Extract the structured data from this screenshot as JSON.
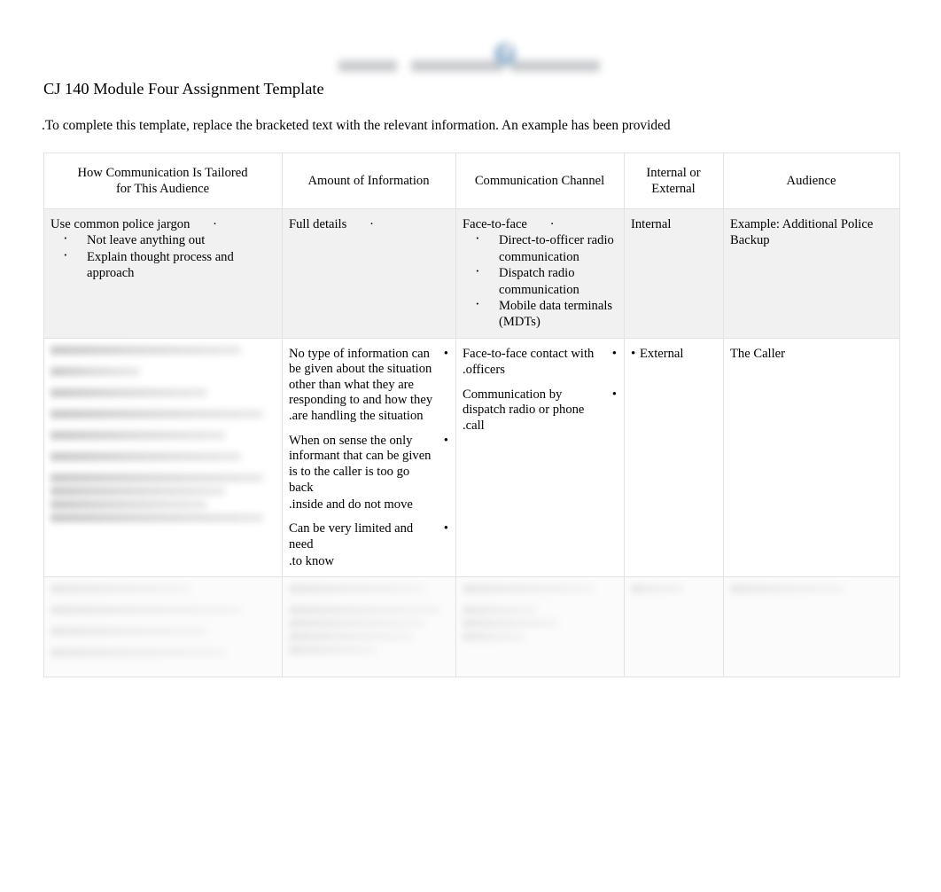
{
  "document": {
    "title": "CJ 140 Module Four Assignment Template",
    "instructions": ".To complete this template, replace the bracketed text with the relevant information. An example has been provided",
    "watermark": "blurred-logo-watermark"
  },
  "table": {
    "headers": [
      {
        "line1": "How Communication Is Tailored",
        "line2": "for This Audience"
      },
      {
        "line1": "Amount of Information",
        "line2": ""
      },
      {
        "line1": "Communication Channel",
        "line2": ""
      },
      {
        "line1": "Internal or",
        "line2": "External"
      },
      {
        "line1": "Audience",
        "line2": ""
      }
    ],
    "rows": [
      {
        "shaded": true,
        "col1": {
          "lead": "Use common police jargon",
          "lead_dot": "·",
          "bullets": [
            "Not leave anything out",
            "Explain thought process and approach"
          ]
        },
        "col2": {
          "lead": "Full details",
          "lead_dot": "·",
          "bullets": []
        },
        "col3": {
          "lead": "Face-to-face",
          "lead_dot": "·",
          "bullets": [
            "Direct-to-officer radio communication",
            "Dispatch radio communication",
            "Mobile data terminals (MDTs)"
          ]
        },
        "col4": {
          "text": "Internal"
        },
        "col5": {
          "text": "Example: Additional Police Backup"
        }
      },
      {
        "shaded": false,
        "col1": {
          "redacted": true
        },
        "col2": {
          "paragraphs": [
            {
              "dot": "•",
              "lines": [
                "No type of information can",
                "be given about the situation",
                "other than what they are",
                "responding to and how they",
                ".are handling the situation"
              ]
            },
            {
              "dot": "•",
              "lines": [
                "When on sense the only",
                "informant that can be given",
                "is to the caller is too go back",
                ".inside and do not move"
              ]
            },
            {
              "dot": "•",
              "lines": [
                "Can be very limited and need",
                ".to know"
              ]
            }
          ]
        },
        "col3": {
          "paragraphs": [
            {
              "dot": "•",
              "lines": [
                "Face-to-face contact with",
                ".officers"
              ]
            },
            {
              "dot": "•",
              "lines": [
                "Communication by",
                "dispatch radio or phone",
                ".call"
              ]
            }
          ]
        },
        "col4": {
          "bullet": "•",
          "text": "External"
        },
        "col5": {
          "text": "The Caller"
        }
      },
      {
        "shaded": false,
        "ghost": true,
        "col1": {
          "redacted": true
        },
        "col2": {
          "redacted": true
        },
        "col3": {
          "redacted": true
        },
        "col4": {
          "redacted": true
        },
        "col5": {
          "redacted": true
        }
      }
    ]
  },
  "colors": {
    "page_background": "#ffffff",
    "text": "#000000",
    "table_border": "#e2e2e2",
    "shaded_row": "#f1f1f1",
    "watermark_gray": "#b9bcc0",
    "watermark_blue": "#7ea4c4"
  }
}
